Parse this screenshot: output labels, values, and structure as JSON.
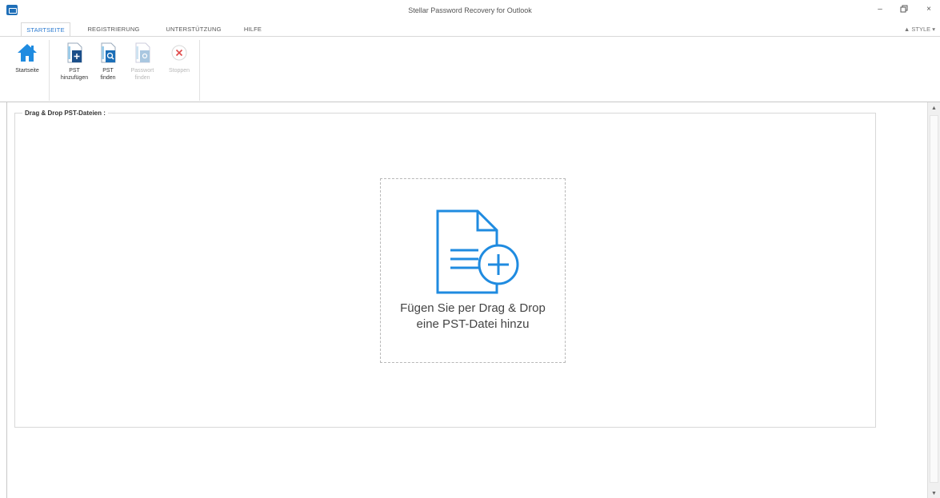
{
  "window": {
    "title": "Stellar Password Recovery for Outlook",
    "minimize_glyph": "–",
    "restore_glyph": "🗗",
    "close_glyph": "×"
  },
  "tabs": [
    {
      "label": "STARTSEITE",
      "active": true
    },
    {
      "label": "REGISTRIERUNG",
      "active": false
    },
    {
      "label": "UNTERSTÜTZUNG",
      "active": false
    },
    {
      "label": "HILFE",
      "active": false
    }
  ],
  "style_menu": "▲ STYLE ▾",
  "ribbon": {
    "home": {
      "label": "Startseite",
      "icon": "home-icon"
    },
    "add_pst": {
      "label_line1": "PST",
      "label_line2": "hinzufügen",
      "icon": "add-file-icon"
    },
    "find_pst": {
      "label_line1": "PST",
      "label_line2": "finden",
      "icon": "search-file-icon"
    },
    "find_password": {
      "label_line1": "Passwort",
      "label_line2": "finden",
      "icon": "password-file-icon",
      "disabled": true
    },
    "stop": {
      "label": "Stoppen",
      "icon": "stop-icon",
      "disabled": true
    }
  },
  "main": {
    "group_title": "Drag & Drop PST-Dateien :",
    "drop_zone": {
      "line1": "Fügen Sie per Drag & Drop",
      "line2": "eine PST-Datei hinzu",
      "icon": "add-document-icon"
    }
  },
  "colors": {
    "accent": "#2a7ad0",
    "icon_blue": "#1f8be0",
    "dark_blue": "#1b4f8a",
    "stop_red": "#e04a4a"
  }
}
